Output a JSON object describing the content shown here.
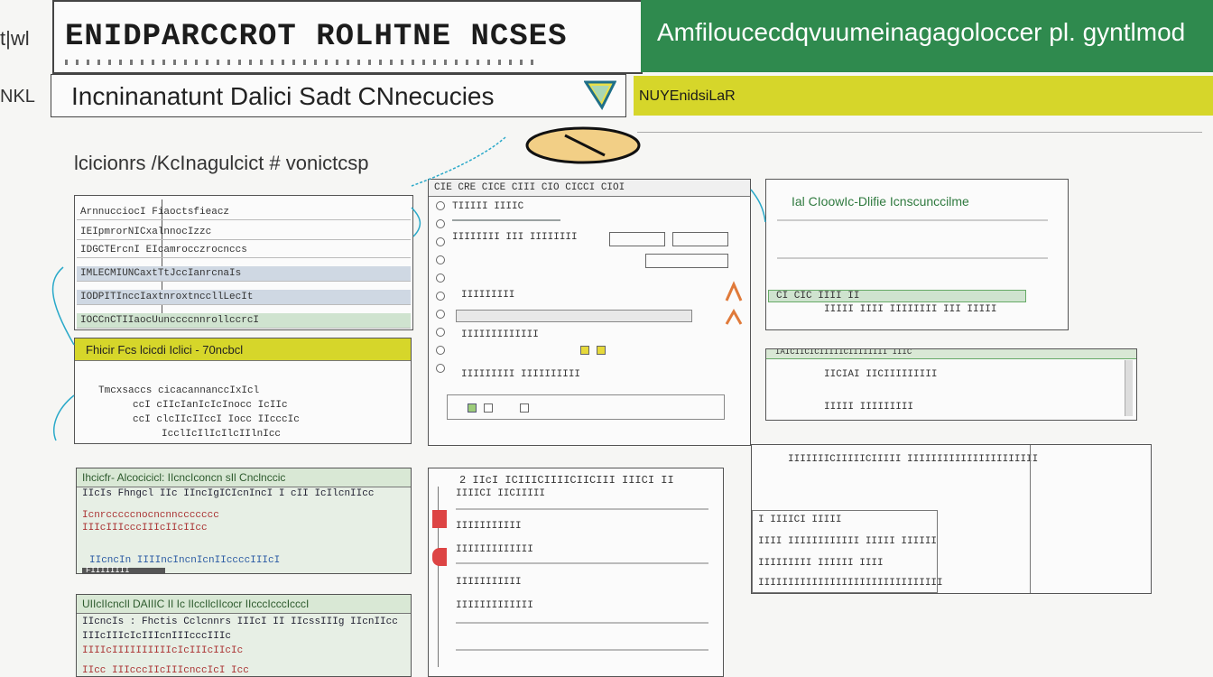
{
  "header": {
    "side_mark_top": "t|wl",
    "side_mark_bottom": "NKL",
    "title": "ENIDPARCCROT ROLHTNE NCSES",
    "green_banner": "Amfiloucecdqvuumeinagagoloccer pl. gyntlmod",
    "subtitle": "Incninanatunt Dalici Sadt CNnecucies",
    "yellow_bar_label": "NUYEnidsiLaR"
  },
  "breadcrumb": "lcicionrs /KcInagulcict # vonictcsp",
  "panels": {
    "p1": {
      "rows": [
        "ArnnucciocI Fiaoctsfieacz",
        "IEIpmrorNICxalnnocIzzc",
        "IDGCTErcnI EIcamrocczrocnccs",
        "IMLECMIUNCaxtTtJccIanrcnaIs",
        "IODPITInccIaxtnroxtnccllLecIt",
        "IOCCnCTIIaocUunccccnnrollccrcI"
      ]
    },
    "p2": {
      "header": "Fhicir Fcs lcicdi Iclici - 70ncbcl",
      "rows": [
        "Tmcxsaccs cicacannanccIxIcl",
        "ccI cIIcIanIcIcInocc IcIIc",
        "ccI clcIIcIIccI Iocc IIcccIc",
        "IcclIcIlIcIlcIIlnIcc"
      ]
    },
    "p3": {
      "toolbar": "CIE CRE CICE CIII CIO CICCI CIOI",
      "rows": [
        "TIIIII IIIIC",
        "IIIIIIII III IIIIIIII",
        "IIIIIIIII",
        "IIIIIIIIIIIII",
        "IIIIIIIII IIIIIIIIII"
      ]
    },
    "p4": {
      "title": "Ial CIoowIc-Dlifie Icnscunccilme",
      "rows": [
        "CI CIC IIII II",
        "IIIII IIII IIIIIIII III IIIII"
      ]
    },
    "p5": {
      "header": "IAICIICICIIIIICIIIIIIII IIIC",
      "rows": [
        "IICIAI IICIIIIIIIII",
        "IIIII IIIIIIIII"
      ]
    },
    "p6": {
      "header": "Ihcicfr- Alcocicicl: IIcncIconcn sIl Cnclnccic",
      "rows": [
        "IIcIs Fhngcl IIc IIncIgICIcnIncI I cII IcIlcnIIcc",
        "Icnrcccccnocncnnccccccc",
        "IIIcIIIcccIIIcIIcIIcc",
        "IIcncIn IIIIncIncnIcnIIccccIIIcI",
        "FIIIIIIII"
      ]
    },
    "p7": {
      "header": "UIIcIIcncIl DAIIIC II Ic IIccIlcIIcocr IIcccIcccIcccI",
      "rows": [
        "IIcncIs : Fhctis Cclcnnrs IIIcI II IIcssIIIg IIcnIIcc",
        "IIIcIIIcIcIIIcnIIIcccIIIc",
        "IIIIcIIIIIIIIIIcIcIIIcIIcIc",
        "IIcc IIIcccIIcIIIcnccIcI Icc"
      ]
    },
    "p8": {
      "header": "2 IIcI ICIIICIIIICIICIII IIICI II",
      "rows": [
        "IIIICI IICIIIII",
        "IIIIIIIIIII",
        "IIIIIIIIIIIII",
        "IIIIIIIIIII",
        "IIIIIIIIIIIII"
      ]
    },
    "p9": {
      "title": "IIIIIIICIIIIICIIIII IIIIIIIIIIIIIIIIIIIIII",
      "rows": [
        "I IIIICI IIIII",
        "IIII IIIIIIIIIIII IIIII IIIIII",
        "IIIIIIIII IIIIII IIII",
        "IIIIIIIIIIIIIIIIIIIIIIIIIIIIIII"
      ]
    }
  },
  "colors": {
    "green": "#2f8a4e",
    "yellow": "#d6d62a",
    "panel_green": "#e7efe5",
    "curve": "#2aa9c9"
  }
}
